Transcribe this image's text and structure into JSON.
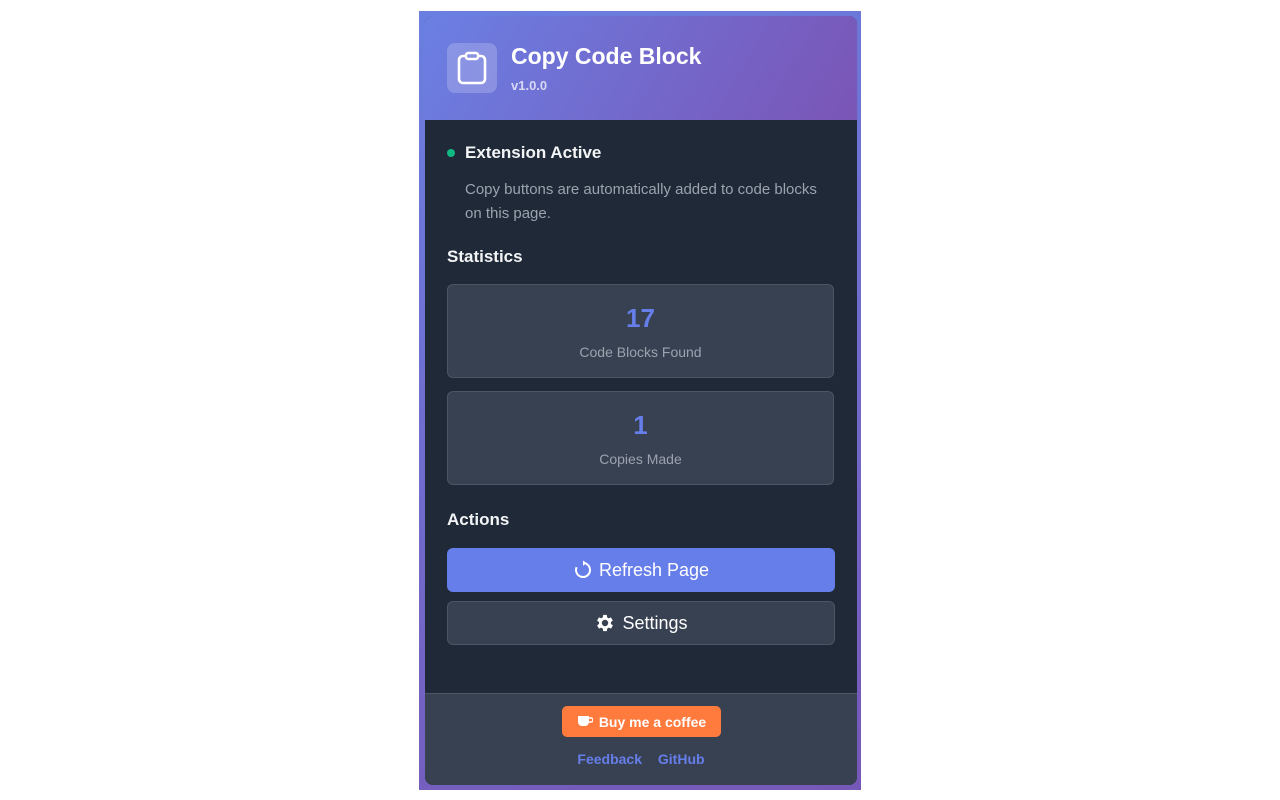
{
  "app": {
    "title": "Copy Code Block",
    "version": "v1.0.0",
    "logo_icon": "clipboard-icon"
  },
  "status": {
    "title": "Extension Active",
    "description": "Copy buttons are automatically added to code blocks on this page.",
    "color": "#10b981"
  },
  "statistics": {
    "section_title": "Statistics",
    "cards": [
      {
        "value": "17",
        "label": "Code Blocks Found"
      },
      {
        "value": "1",
        "label": "Copies Made"
      }
    ]
  },
  "actions": {
    "section_title": "Actions",
    "refresh_label": "Refresh Page",
    "refresh_icon": "refresh-icon",
    "settings_label": "Settings",
    "settings_icon": "gear-icon"
  },
  "footer": {
    "coffee_label": "Buy me a coffee",
    "coffee_icon": "coffee-cup-icon",
    "links": [
      {
        "label": "Feedback"
      },
      {
        "label": "GitHub"
      }
    ]
  },
  "colors": {
    "accent": "#667eea",
    "header_gradient_start": "#6b7fe3",
    "header_gradient_end": "#7a55b6",
    "background": "#1f2937",
    "card": "#374151",
    "coffee": "#ff7a3d"
  }
}
